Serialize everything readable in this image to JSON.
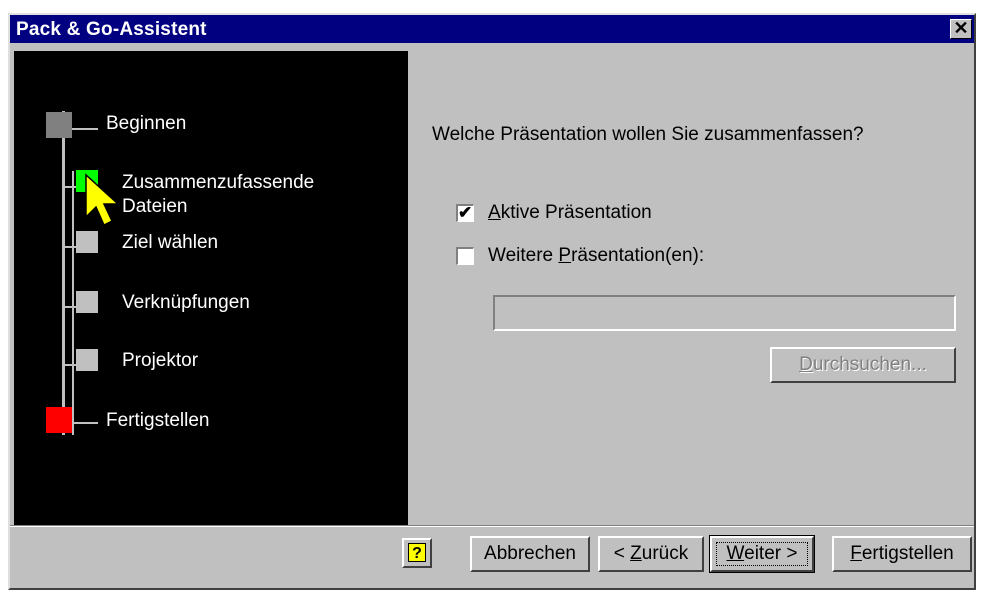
{
  "window": {
    "title": "Pack & Go-Assistent",
    "close_glyph": "✕"
  },
  "steps": [
    {
      "label": "Beginnen",
      "color": "#808080"
    },
    {
      "label": "Zusammenzufassende\nDateien",
      "color": "#00ff00"
    },
    {
      "label": "Ziel wählen",
      "color": "#c0c0c0"
    },
    {
      "label": "Verknüpfungen",
      "color": "#c0c0c0"
    },
    {
      "label": "Projektor",
      "color": "#c0c0c0"
    },
    {
      "label": "Fertigstellen",
      "color": "#ff0000"
    }
  ],
  "main": {
    "question": "Welche Präsentation wollen Sie zusammenfassen?",
    "option_active": {
      "underlined": "A",
      "rest": "ktive Präsentation",
      "checked": true
    },
    "option_other": {
      "before": "Weitere ",
      "underlined": "P",
      "rest": "räsentation(en):",
      "checked": false
    },
    "path_value": "",
    "browse_button": {
      "underlined": "D",
      "rest": "urchsuchen..."
    }
  },
  "footer": {
    "help_label": "?",
    "cancel_label": "Abbrechen",
    "back_before": "< ",
    "back_underlined": "Z",
    "back_rest": "urück",
    "next_underlined": "W",
    "next_rest": "eiter >",
    "finish_underlined": "F",
    "finish_rest": "ertigstellen"
  },
  "icons": {
    "cursor": "arrow-cursor-icon",
    "help": "help-icon",
    "close": "close-icon"
  }
}
